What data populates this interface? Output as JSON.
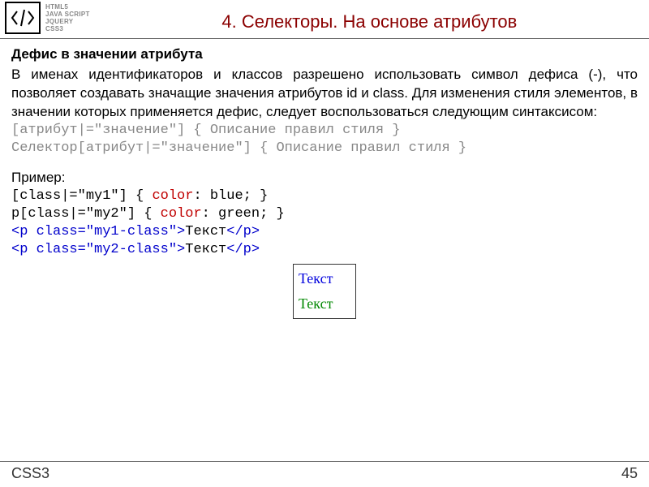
{
  "header": {
    "tech_labels": [
      "HTML5",
      "JAVA SCRIPT",
      "JQUERY",
      "CSS3"
    ],
    "title": "4. Селекторы. На основе атрибутов"
  },
  "content": {
    "subtitle": "Дефис в значении атрибута",
    "paragraph": "В именах идентификаторов и классов разрешено использовать символ дефиса (-), что позволяет создавать значащие значения атрибутов id и class. Для изменения стиля элементов, в значении которых применяется дефис, следует воспользоваться следующим синтаксисом:",
    "syntax_line1": "[атрибут|=\"значение\"] { Описание правил стиля }",
    "syntax_line2": "Селектор[атрибут|=\"значение\"] { Описание правил стиля }",
    "example_label": "Пример:",
    "code": {
      "l1_a": "[class|=\"my1\"] { ",
      "l1_kw": "color",
      "l1_b": ": blue; }",
      "l2_a": "p[class|=\"my2\"] { ",
      "l2_kw": "color",
      "l2_b": ": green; }",
      "l3_a": "<p class=\"my1-class\">",
      "l3_b": "Текст",
      "l3_c": "</p>",
      "l4_a": "<p class=\"my2-class\">",
      "l4_b": "Текст",
      "l4_c": "</p>"
    },
    "result": {
      "line1": "Текст",
      "line2": "Текст"
    }
  },
  "footer": {
    "left": "CSS3",
    "right": "45"
  }
}
